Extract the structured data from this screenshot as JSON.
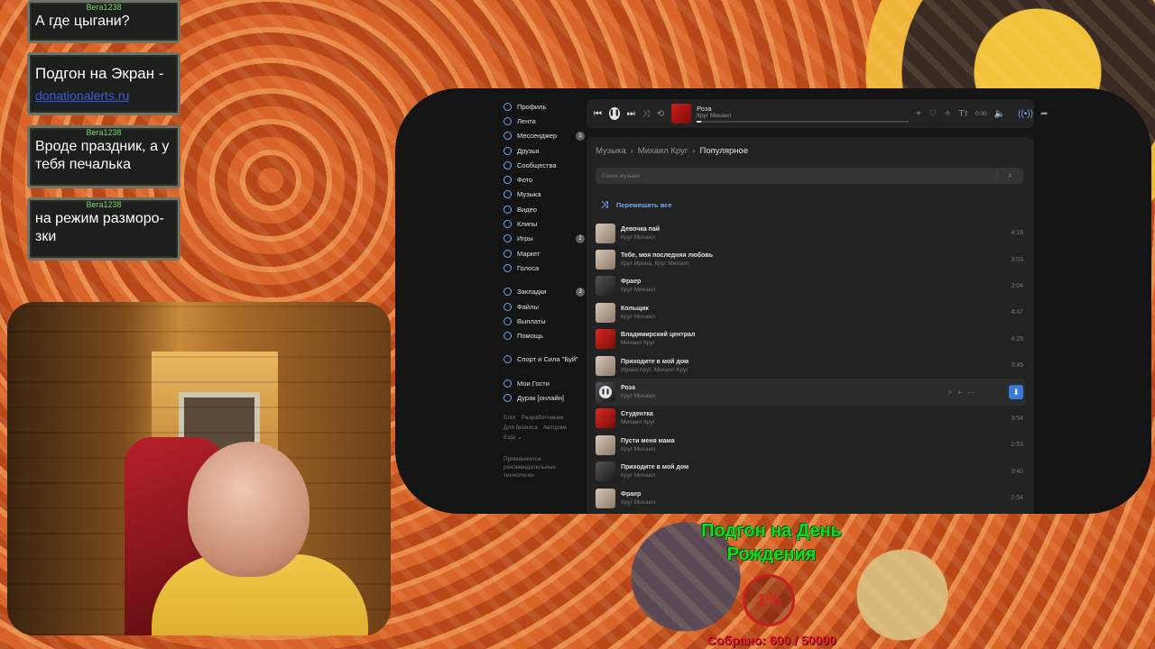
{
  "chat": [
    {
      "user": "Вега1238",
      "text": "А где цыгани?",
      "link": ""
    },
    {
      "user": "",
      "text": "Подгон на Экран -",
      "link": "donationalerts.ru"
    },
    {
      "user": "Вега1238",
      "text": "Вроде праздник, а у тебя печалька",
      "link": ""
    },
    {
      "user": "Вега1238",
      "text": "на режим разморо-зки",
      "link": ""
    }
  ],
  "sidebar": {
    "items": [
      {
        "label": "Профиль",
        "badge": ""
      },
      {
        "label": "Лента",
        "badge": ""
      },
      {
        "label": "Мессенджер",
        "badge": "1"
      },
      {
        "label": "Друзья",
        "badge": ""
      },
      {
        "label": "Сообщества",
        "badge": ""
      },
      {
        "label": "Фото",
        "badge": ""
      },
      {
        "label": "Музыка",
        "badge": ""
      },
      {
        "label": "Видео",
        "badge": ""
      },
      {
        "label": "Клипы",
        "badge": ""
      },
      {
        "label": "Игры",
        "badge": "2"
      },
      {
        "label": "Маркет",
        "badge": ""
      },
      {
        "label": "Голоса",
        "badge": ""
      }
    ],
    "items2": [
      {
        "label": "Закладки",
        "badge": "3"
      },
      {
        "label": "Файлы",
        "badge": ""
      },
      {
        "label": "Выплаты",
        "badge": ""
      },
      {
        "label": "Помощь",
        "badge": ""
      }
    ],
    "community": "Спорт и Сила \"Буй\"",
    "apps": [
      {
        "label": "Мои Гости"
      },
      {
        "label": "Дурак [онлайн]"
      }
    ],
    "footer": [
      "Блог",
      "Разработчикам",
      "Для бизнеса",
      "Авторам",
      "Ещё ⌄"
    ],
    "note": "Применяются рекомендательные технологии"
  },
  "player": {
    "title": "Роза",
    "artist": "Круг Михаил",
    "time": "0:00",
    "progress": 0.02,
    "icons": [
      "prev-icon",
      "pause-icon",
      "next-icon",
      "shuffle-icon",
      "repeat-icon",
      "plus-icon",
      "dislike-icon",
      "sparkle-icon",
      "lyrics-icon",
      "volume-icon",
      "broadcast-icon",
      "share-icon"
    ]
  },
  "breadcrumb": {
    "a": "Музыка",
    "b": "Михаил Круг",
    "c": "Популярное"
  },
  "search": {
    "placeholder": "Поиск музыки"
  },
  "shuffle_label": "Перемешать все",
  "tracks": [
    {
      "title": "Девочка пай",
      "artist": "Круг Михаил",
      "dur": "4:18",
      "thumb": "light"
    },
    {
      "title": "Тебе, моя последняя любовь",
      "artist": "Круг Ирина, Круг Михаил",
      "dur": "3:03",
      "thumb": "light"
    },
    {
      "title": "Фраер",
      "artist": "Круг Михаил",
      "dur": "3:04",
      "thumb": "dark"
    },
    {
      "title": "Кольщик",
      "artist": "Круг Михаил",
      "dur": "4:47",
      "thumb": "light"
    },
    {
      "title": "Владимирский централ",
      "artist": "Михаил Круг",
      "dur": "4:25",
      "thumb": "red"
    },
    {
      "title": "Приходите в мой дом",
      "artist": "Ирина Круг, Михаил Круг",
      "dur": "3:45",
      "thumb": "light"
    },
    {
      "title": "Роза",
      "artist": "Круг Михаил",
      "dur": "",
      "thumb": "dark",
      "active": true
    },
    {
      "title": "Студентка",
      "artist": "Михаил Круг",
      "dur": "3:54",
      "thumb": "red"
    },
    {
      "title": "Пусти меня мама",
      "artist": "Круг Михаил",
      "dur": "2:53",
      "thumb": "light"
    },
    {
      "title": "Приходите в мой дом",
      "artist": "Круг Михаил",
      "dur": "3:40",
      "thumb": "dark"
    },
    {
      "title": "Фраер",
      "artist": "Круг Михаил",
      "dur": "2:54",
      "thumb": "light"
    }
  ],
  "donation": {
    "goal": "Подгон на День Рождения",
    "percent": "1%",
    "collected": "Собрано: 600 / 50000"
  }
}
